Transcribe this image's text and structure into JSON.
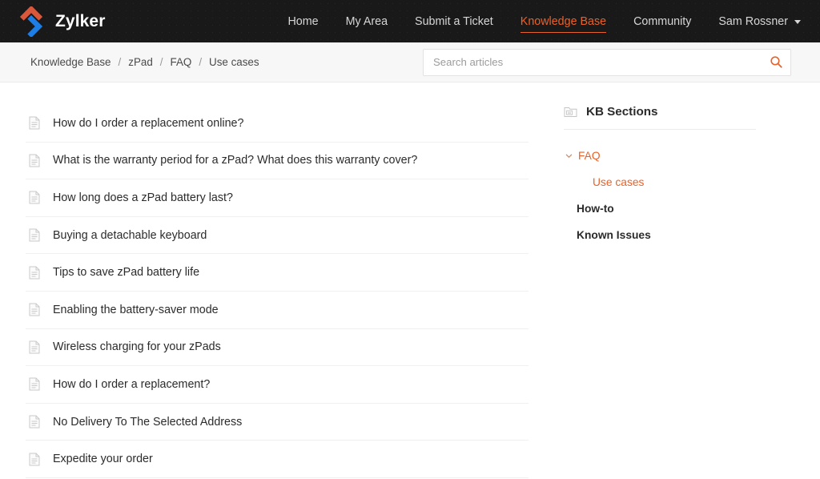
{
  "header": {
    "brand_name": "Zylker",
    "logo_icon": "zylker-diamond-logo",
    "nav": [
      {
        "label": "Home",
        "active": false
      },
      {
        "label": "My Area",
        "active": false
      },
      {
        "label": "Submit a Ticket",
        "active": false
      },
      {
        "label": "Knowledge Base",
        "active": true
      },
      {
        "label": "Community",
        "active": false
      }
    ],
    "user": {
      "name": "Sam Rossner",
      "caret_icon": "chevron-down-icon"
    }
  },
  "breadcrumb": {
    "separator": "/",
    "items": [
      "Knowledge Base",
      "zPad",
      "FAQ",
      "Use cases"
    ]
  },
  "search": {
    "placeholder": "Search articles",
    "value": "",
    "icon": "search-icon"
  },
  "articles": {
    "item_icon": "document-icon",
    "items": [
      "How do I order a replacement online?",
      "What is the warranty period for a zPad? What does this warranty cover?",
      "How long does a zPad battery last?",
      "Buying a detachable keyboard",
      "Tips to save zPad battery life",
      "Enabling the battery-saver mode",
      "Wireless charging for your zPads",
      "How do I order a replacement?",
      "No Delivery To The Selected Address",
      "Expedite your order"
    ]
  },
  "kb_sections": {
    "title": "KB Sections",
    "title_icon": "folder-icon",
    "nodes": [
      {
        "label": "FAQ",
        "level": 0,
        "expanded": true,
        "selected": false,
        "accent": true
      },
      {
        "label": "Use cases",
        "level": 1,
        "expanded": false,
        "selected": true,
        "accent": true
      },
      {
        "label": "How-to",
        "level": 0,
        "expanded": false,
        "selected": false,
        "accent": false
      },
      {
        "label": "Known Issues",
        "level": 0,
        "expanded": false,
        "selected": false,
        "accent": false
      }
    ]
  },
  "colors": {
    "header_bg": "#191919",
    "accent": "#e8622b",
    "crumb_bg": "#f7f7f7",
    "text": "#2b2b2b",
    "divider": "#f0f0f0"
  }
}
